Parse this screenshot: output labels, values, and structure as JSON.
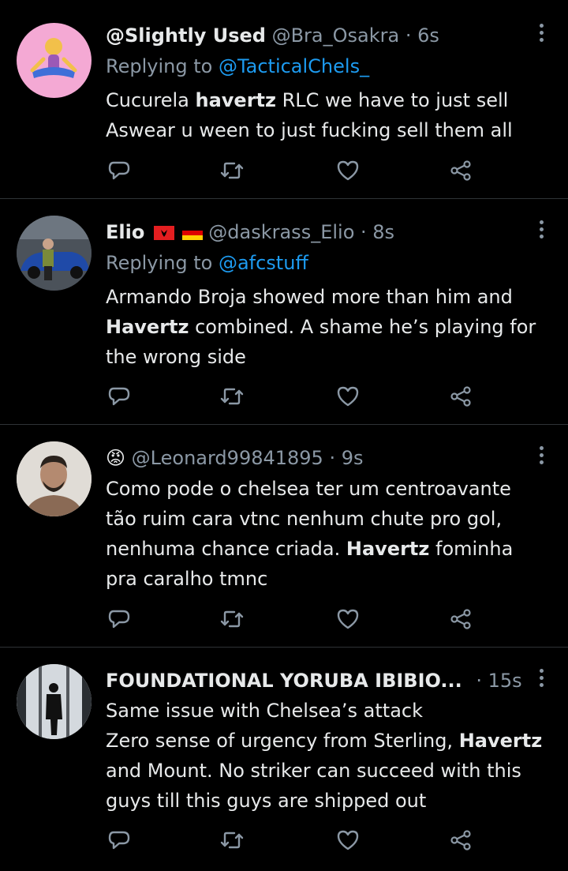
{
  "tweets": [
    {
      "name": "@Slightly Used",
      "handle": "@Bra_Osakra",
      "time": "· 6s",
      "replying_prefix": "Replying to ",
      "replying_to": "@TacticalChels_",
      "body": [
        [
          {
            "t": "Cucurela ",
            "b": false
          },
          {
            "t": "havertz",
            "b": true
          },
          {
            "t": " RLC we have to just sell",
            "b": false
          }
        ],
        [
          {
            "t": "Aswear u ween to just fucking sell them all",
            "b": false
          }
        ]
      ],
      "avatar_icon": "person-meditating-emoji"
    },
    {
      "name": "Elio",
      "flags": [
        "albania-flag-icon",
        "germany-flag-icon"
      ],
      "handle": "@daskrass_Elio",
      "time": "· 8s",
      "replying_prefix": "Replying to ",
      "replying_to": "@afcstuff",
      "body": [
        [
          {
            "t": "Armando Broja showed more than him and",
            "b": false
          }
        ],
        [
          {
            "t": "Havertz",
            "b": true
          },
          {
            "t": " combined. A shame he’s playing for",
            "b": false
          }
        ],
        [
          {
            "t": "the wrong side",
            "b": false
          }
        ]
      ],
      "avatar_icon": "person-with-car-photo"
    },
    {
      "name": "😡",
      "handle": "@Leonard99841895",
      "time": "· 9s",
      "body": [
        [
          {
            "t": "Como pode o chelsea ter um centroavante",
            "b": false
          }
        ],
        [
          {
            "t": "tão ruim cara vtnc nenhum chute pro gol,",
            "b": false
          }
        ],
        [
          {
            "t": "nenhuma chance criada. ",
            "b": false
          },
          {
            "t": "Havertz",
            "b": true
          },
          {
            "t": " fominha",
            "b": false
          }
        ],
        [
          {
            "t": "pra caralho tmnc",
            "b": false
          }
        ]
      ],
      "avatar_icon": "man-portrait-photo"
    },
    {
      "name": "FOUNDATIONAL YORUBA IBIBIO...",
      "handle": "",
      "time": "· 15s",
      "body": [
        [
          {
            "t": "Same issue with Chelsea’s attack",
            "b": false
          }
        ],
        [
          {
            "t": "Zero sense of urgency from Sterling, ",
            "b": false
          },
          {
            "t": "Havertz",
            "b": true
          }
        ],
        [
          {
            "t": "and Mount. No striker can succeed with this",
            "b": false
          }
        ],
        [
          {
            "t": "guys till this guys are shipped out",
            "b": false
          }
        ]
      ],
      "avatar_icon": "silhouette-window-photo"
    }
  ],
  "actions": [
    "reply-icon",
    "retweet-icon",
    "like-icon",
    "share-icon"
  ],
  "colors": {
    "background": "#000000",
    "text": "#e7e9ea",
    "muted": "#8b98a5",
    "link": "#1d9bf0",
    "divider": "#2f3336"
  }
}
